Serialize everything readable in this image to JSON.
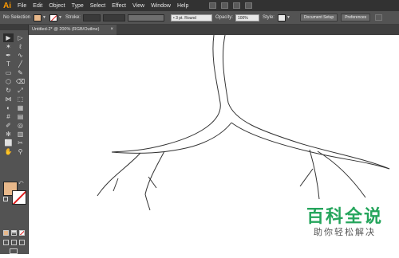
{
  "menubar": {
    "logo": "Ai",
    "items": [
      "File",
      "Edit",
      "Object",
      "Type",
      "Select",
      "Effect",
      "View",
      "Window",
      "Help"
    ]
  },
  "controlbar": {
    "selection": "No Selection",
    "stroke_label": "Stroke:",
    "stroke_profile": "3 pt. Round",
    "opacity_label": "Opacity:",
    "opacity_value": "100%",
    "style_label": "Style:",
    "document_setup": "Document Setup",
    "preferences": "Preferences",
    "fill_color": "#e8b88a"
  },
  "tab": {
    "title": "Untitled-2* @ 200% (RGB/Outline)",
    "close": "×"
  },
  "tools": {
    "icons": [
      "selection-icon",
      "direct-selection-icon",
      "magic-wand-icon",
      "lasso-icon",
      "pen-icon",
      "curvature-icon",
      "type-icon",
      "line-segment-icon",
      "rectangle-icon",
      "paintbrush-icon",
      "shaper-icon",
      "eraser-icon",
      "rotate-icon",
      "scale-icon",
      "width-icon",
      "free-transform-icon",
      "shape-builder-icon",
      "perspective-grid-icon",
      "mesh-icon",
      "gradient-icon",
      "eyedropper-icon",
      "blend-icon",
      "symbol-sprayer-icon",
      "column-graph-icon",
      "artboard-icon",
      "slice-icon",
      "hand-icon",
      "zoom-icon"
    ],
    "glyphs": [
      "▶",
      "▷",
      "✶",
      "ℓ",
      "✒",
      "∿",
      "T",
      "╱",
      "▭",
      "✎",
      "⬡",
      "⌫",
      "↻",
      "⤢",
      "⋈",
      "⬚",
      "◐",
      "▦",
      "#",
      "▤",
      "✐",
      "◎",
      "✻",
      "▥",
      "⬜",
      "✂",
      "✋",
      "⚲"
    ]
  },
  "watermark": {
    "title": "百科全说",
    "subtitle": "助你轻松解决"
  }
}
